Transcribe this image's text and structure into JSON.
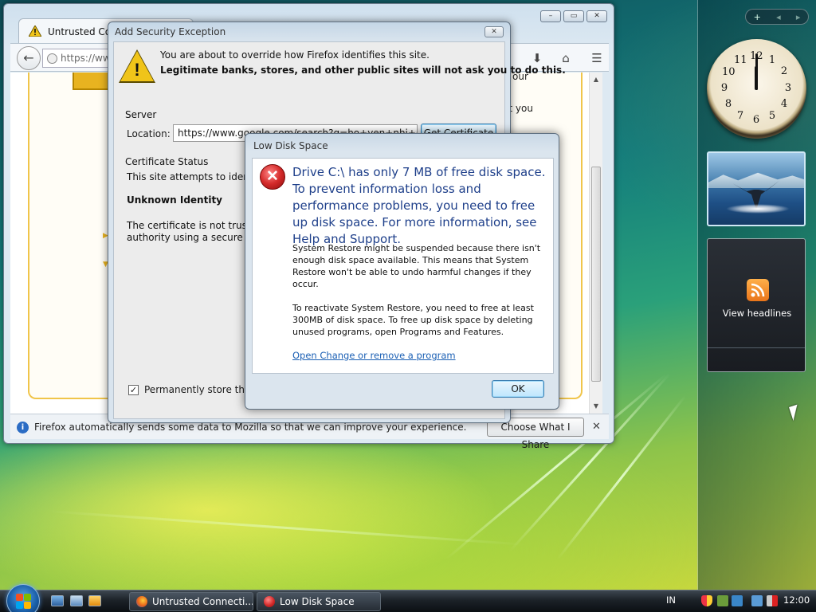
{
  "sidebar": {
    "controls": {
      "add": "+",
      "prev": "◂",
      "next": "▸"
    },
    "clock": {
      "numbers": [
        "12",
        "1",
        "2",
        "3",
        "4",
        "5",
        "6",
        "7",
        "8",
        "9",
        "10",
        "11"
      ],
      "time": "12:00"
    },
    "feed": {
      "label": "View headlines"
    }
  },
  "firefox": {
    "tab_title": "Untrusted Conn",
    "url": "https://www",
    "window_buttons": [
      "–",
      "▭",
      "✕"
    ],
    "page_text_right_1": "our",
    "page_text_right_2": "at you",
    "notification": {
      "message": "Firefox automatically sends some data to Mozilla so that we can improve your experience.",
      "button": "Choose What I Share",
      "close": "✕"
    }
  },
  "security_exception": {
    "title": "Add Security Exception",
    "close": "✕",
    "warning_line1": "You are about to override how Firefox identifies this site.",
    "warning_line2": "Legitimate banks, stores, and other public sites will not ask you to do this.",
    "server_group": "Server",
    "location_label": "Location:",
    "location_value": "https://www.google.com/search?q=ho+yen+nhi+chet&",
    "get_certificate": "Get Certificate",
    "status_group": "Certificate Status",
    "status_text": "This site attempts to identify",
    "unknown_identity": "Unknown Identity",
    "cert_text_1": "The certificate is not trusted",
    "cert_text_2": "authority using a secure sign",
    "permanent_label": "Permanently store this e",
    "permanent_checked": true,
    "check_mark": "✓"
  },
  "low_disk": {
    "title": "Low Disk Space",
    "main_message": "Drive C:\\ has only 7 MB of free disk space. To prevent information loss and performance problems, you need to free up disk space. For more information, see Help and Support.",
    "paragraph_1": "System Restore might be suspended because there isn't enough disk space available. This means that System Restore won't be able to undo harmful changes if they occur.",
    "paragraph_2": "To reactivate System Restore, you need to free at least 300MB of disk space. To free up disk space by deleting unused programs, open Programs and Features.",
    "link": "Open Change or remove a program",
    "ok": "OK"
  },
  "taskbar": {
    "buttons": [
      {
        "label": "Untrusted Connecti..."
      },
      {
        "label": "Low Disk Space"
      }
    ],
    "language": "IN",
    "time": "12:00"
  },
  "colors": {
    "dialog_main_text": "#1e3f8a",
    "link": "#1a5fb4",
    "error_red": "#d42a2a",
    "warning_yellow": "#f0c419"
  }
}
